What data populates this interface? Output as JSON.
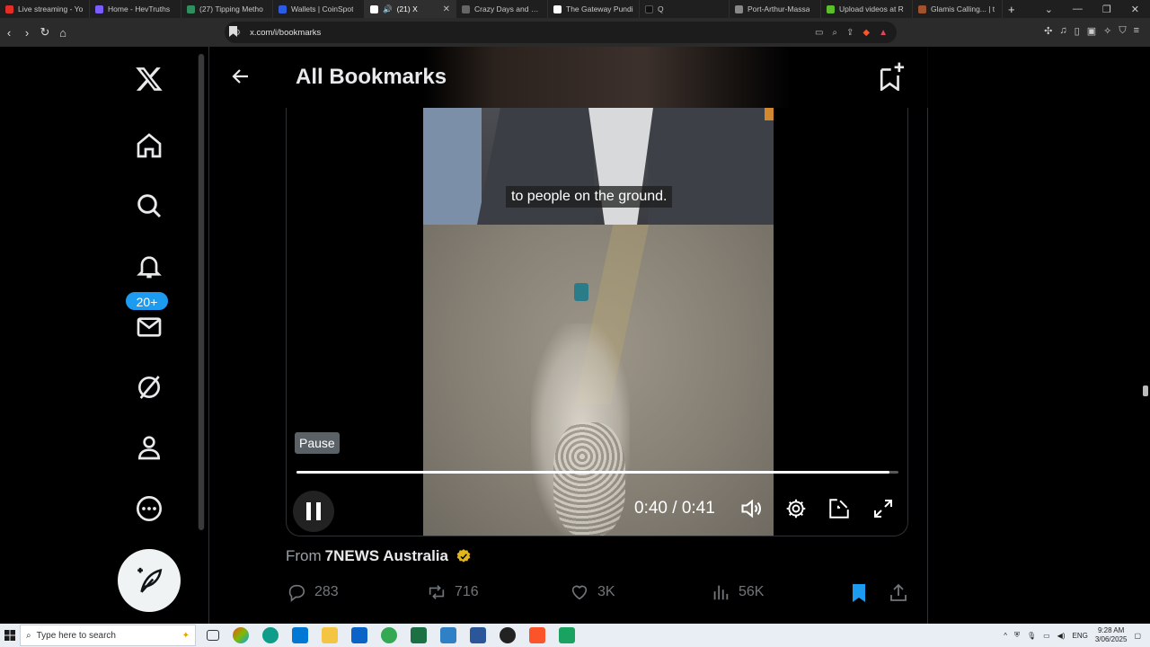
{
  "browser": {
    "tabs": [
      {
        "label": "Live streaming - Yo",
        "color": "#e52d27"
      },
      {
        "label": "Home - HevTruths",
        "color": "#7b5cff"
      },
      {
        "label": "(27) Tipping Metho",
        "color": "#2f8f5f"
      },
      {
        "label": "Wallets | CoinSpot",
        "color": "#2d5be3"
      },
      {
        "label": "(21) X",
        "color": "#000000",
        "active": true
      },
      {
        "label": "Crazy Days and Nig",
        "color": "#666666"
      },
      {
        "label": "The Gateway Pundi",
        "color": "#ffffff"
      },
      {
        "label": "Q",
        "color": "#111111"
      },
      {
        "label": "Port-Arthur-Massa",
        "color": "#888888"
      },
      {
        "label": "Upload videos at R",
        "color": "#5bbf2a"
      },
      {
        "label": "Glamis Calling... | t",
        "color": "#a0522d"
      }
    ],
    "new_tab": "+",
    "url": "x.com/i/bookmarks"
  },
  "sidebar": {
    "notification_badge": "20+"
  },
  "header": {
    "title": "All Bookmarks"
  },
  "video": {
    "caption": "to people on the ground.",
    "tooltip": "Pause",
    "time": "0:40 / 0:41",
    "progress": 0.985
  },
  "post": {
    "from_prefix": "From",
    "source": "7NEWS Australia",
    "replies": "283",
    "reposts": "716",
    "likes": "3K",
    "views": "56K"
  },
  "taskbar": {
    "search_placeholder": "Type here to search",
    "lang": "ENG",
    "time": "9:28 AM",
    "date": "3/06/2025"
  },
  "colors": {
    "accent": "#1d9bf0",
    "verified": "#e2b719"
  }
}
